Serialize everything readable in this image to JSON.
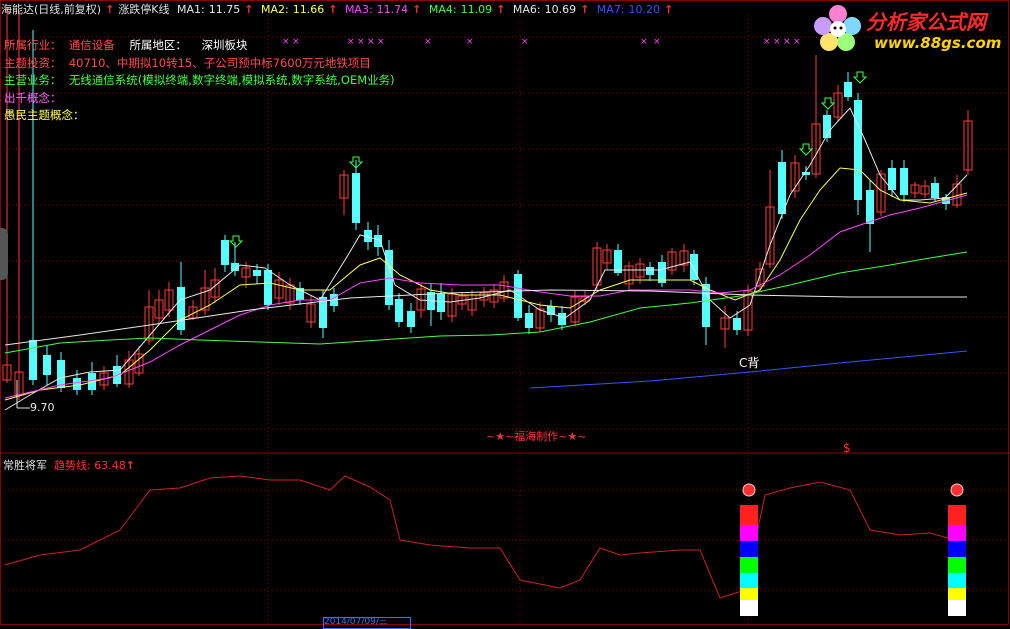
{
  "header": {
    "stock_name": "海能达(日线,前复权)",
    "indicator_arrow": "↑",
    "indicator_name": "涨跌停K线",
    "mas": [
      {
        "label": "MA1:",
        "value": "11.75",
        "arrow": "↑",
        "color": "#e8e8e8"
      },
      {
        "label": "MA2:",
        "value": "11.66",
        "arrow": "↑",
        "color": "#ffff55"
      },
      {
        "label": "MA3:",
        "value": "11.74",
        "arrow": "↑",
        "color": "#ff44ff"
      },
      {
        "label": "MA4:",
        "value": "11.09",
        "arrow": "↑",
        "color": "#44ff44"
      },
      {
        "label": "MA6:",
        "value": "10.69",
        "arrow": "↑",
        "color": "#e8e8e8"
      },
      {
        "label": "MA7:",
        "value": "10.20",
        "arrow": "↑",
        "color": "#3355ff"
      }
    ]
  },
  "logo": {
    "title": "分析家公式网",
    "url": "www.88gs.com"
  },
  "info": {
    "industry_label": "所属行业：",
    "industry_value": "通信设备",
    "region_label": "所属地区：",
    "region_value": "深圳板块",
    "investment_label": "主题投资：",
    "investment_value": "40710、中期拟10转15、子公司预中标7600万元地铁项目",
    "business_label": "主营业务：",
    "business_value": "无线通信系统(模拟终端,数字终端,模拟系统,数字系统,OEM业务)",
    "concept1_label": "出千概念：",
    "concept2_label": "愚民主题概念："
  },
  "annotations": {
    "low_price": "9.70",
    "c_back": "C背",
    "watermark": "~★~福海制作~★~",
    "dollar": "$"
  },
  "lower_panel": {
    "name": "常胜将军",
    "line_label": "趋势线:",
    "line_value": "63.48",
    "arrow": "↑"
  },
  "bottom_bar": {
    "date_box": "2014/07/09/三"
  },
  "colors": {
    "up": "#ff3c3c",
    "down": "#54ffff",
    "ma1": "#e8e8e8",
    "ma2": "#ffff55",
    "ma3": "#ff44ff",
    "ma4": "#44ff44",
    "ma6": "#e8e8e8",
    "ma7": "#3355ff",
    "grid": "#8b0000",
    "trend": "#cc2222"
  }
}
